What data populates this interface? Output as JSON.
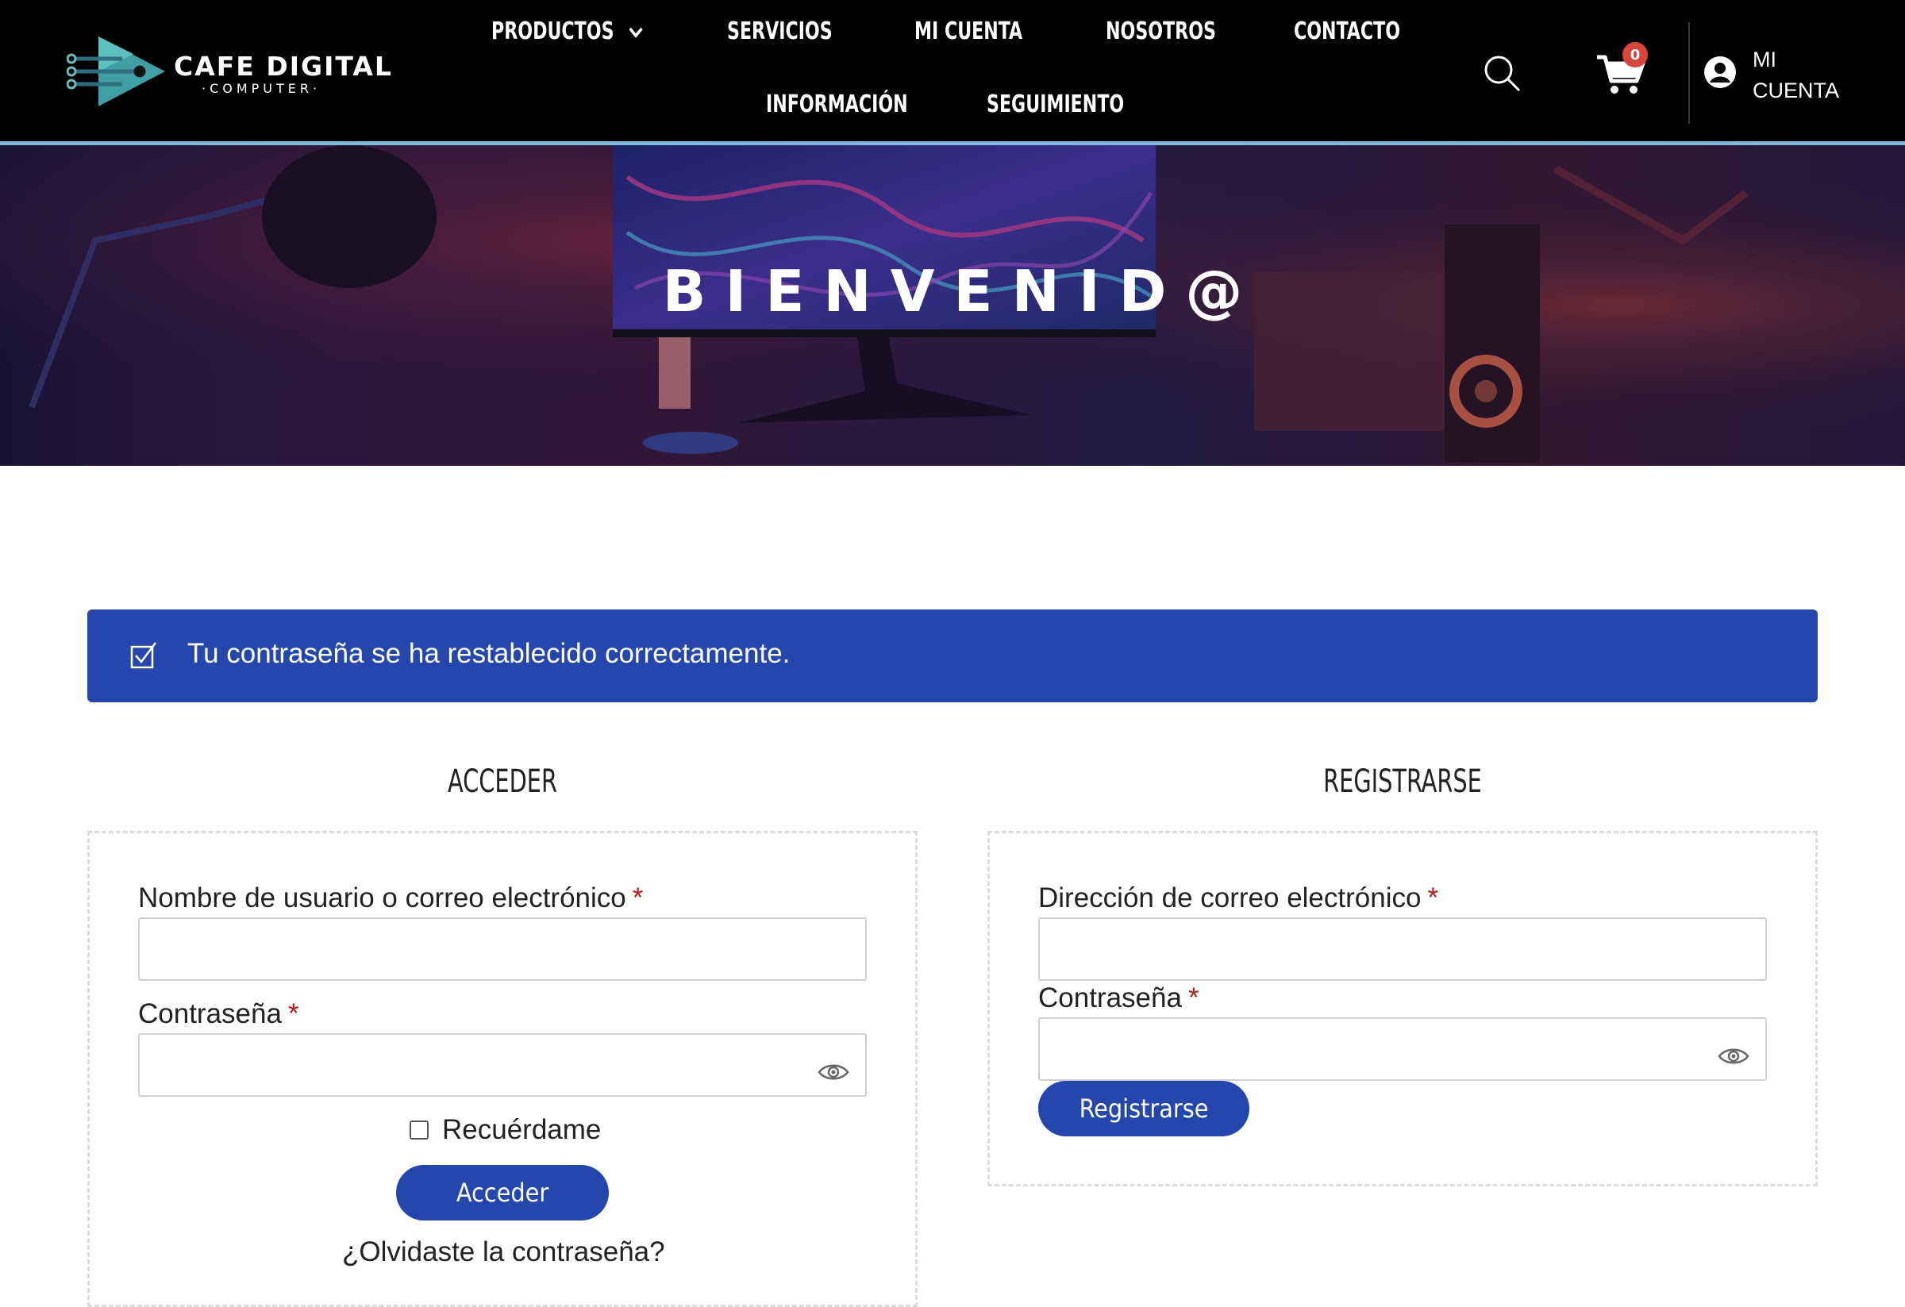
{
  "brand": {
    "name": "CAFE DIGITAL",
    "tagline": "·COMPUTER·",
    "colors": {
      "header_bg": "#000000",
      "accent": "#2446ad",
      "logo_teal": "#4aa8a8",
      "cart_badge": "#d9463b"
    }
  },
  "nav": {
    "items": [
      {
        "label": "PRODUCTOS",
        "has_dropdown": true
      },
      {
        "label": "SERVICIOS"
      },
      {
        "label": "MI CUENTA"
      },
      {
        "label": "NOSOTROS"
      },
      {
        "label": "CONTACTO"
      },
      {
        "label": "INFORMACIÓN"
      },
      {
        "label": "SEGUIMIENTO"
      }
    ],
    "search_icon": "search-icon",
    "cart": {
      "icon": "cart-icon",
      "count": "0"
    },
    "account": {
      "icon": "user-circle-icon",
      "line1": "MI",
      "line2": "CUENTA"
    }
  },
  "hero": {
    "title": "BIENVENID@"
  },
  "notice": {
    "icon": "checkbox-checked-icon",
    "text": "Tu contraseña se ha restablecido correctamente."
  },
  "login": {
    "title": "ACCEDER",
    "username_label": "Nombre de usuario o correo electrónico",
    "username_value": "",
    "password_label": "Contraseña",
    "password_value": "",
    "required_mark": "*",
    "remember_label": "Recuérdame",
    "submit_label": "Acceder",
    "forgot_label": "¿Olvidaste la contraseña?"
  },
  "register": {
    "title": "REGISTRARSE",
    "email_label": "Dirección de correo electrónico",
    "email_value": "",
    "password_label": "Contraseña",
    "password_value": "",
    "required_mark": "*",
    "submit_label": "Registrarse"
  }
}
